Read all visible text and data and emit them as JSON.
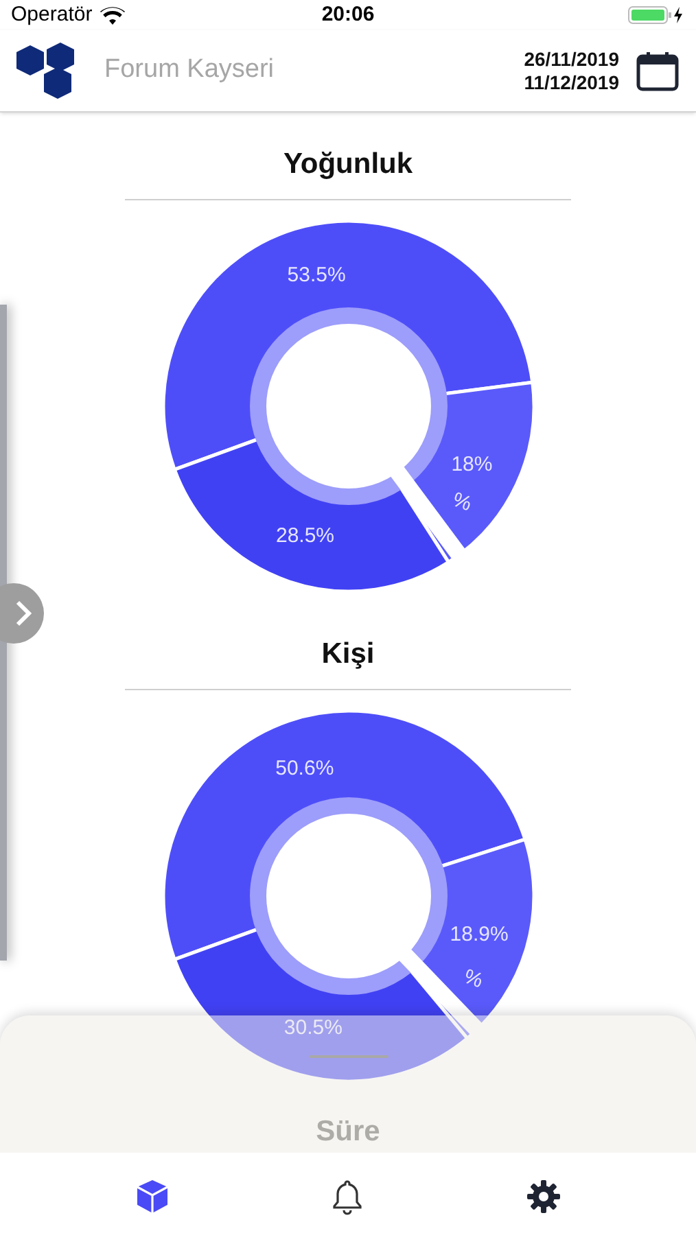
{
  "status_bar": {
    "carrier": "Operatör",
    "time": "20:06"
  },
  "header": {
    "title": "Forum Kayseri",
    "date_start": "26/11/2019",
    "date_end": "11/12/2019"
  },
  "sections": [
    {
      "title": "Yoğunluk",
      "chart_data": {
        "type": "donut",
        "values": [
          53.5,
          18,
          28.5
        ],
        "value_labels": [
          "53.5%",
          "18%",
          "28.5%"
        ],
        "annotations": [
          {
            "text": "%"
          }
        ]
      }
    },
    {
      "title": "Kişi",
      "chart_data": {
        "type": "donut",
        "values": [
          50.6,
          18.9,
          30.5
        ],
        "value_labels": [
          "50.6%",
          "18.9%",
          "30.5%"
        ],
        "annotations": [
          {
            "text": "%"
          }
        ]
      }
    }
  ],
  "sheet": {
    "peek_title": "Süre"
  },
  "tab_bar": [
    {
      "kind": "cube",
      "selected": true
    },
    {
      "kind": "bell",
      "selected": false
    },
    {
      "kind": "gear",
      "selected": false
    }
  ]
}
